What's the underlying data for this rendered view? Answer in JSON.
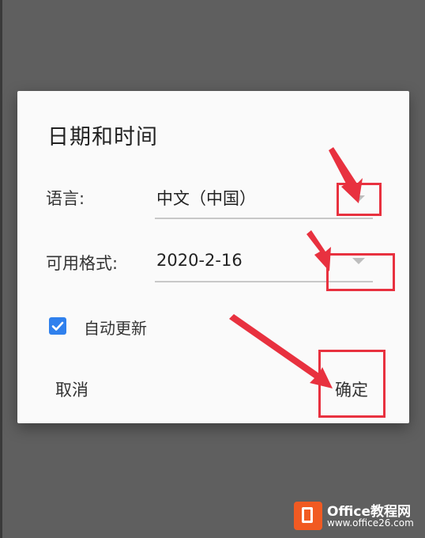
{
  "dialog": {
    "title": "日期和时间",
    "language": {
      "label": "语言:",
      "value": "中文（中国）"
    },
    "format": {
      "label": "可用格式:",
      "value": "2020-2-16"
    },
    "auto_update": {
      "label": "自动更新",
      "checked": true
    },
    "cancel_label": "取消",
    "confirm_label": "确定"
  },
  "annotations": {
    "color": "#e8313f"
  },
  "watermark": {
    "brand": "Office教程网",
    "url": "www.office26.com"
  },
  "colors": {
    "overlay": "#5f5f5f",
    "dialog_bg": "#fafafa",
    "checkbox": "#2f80ed"
  },
  "icons": [
    "dropdown-caret-icon",
    "checkmark-icon",
    "office-logo-icon"
  ]
}
